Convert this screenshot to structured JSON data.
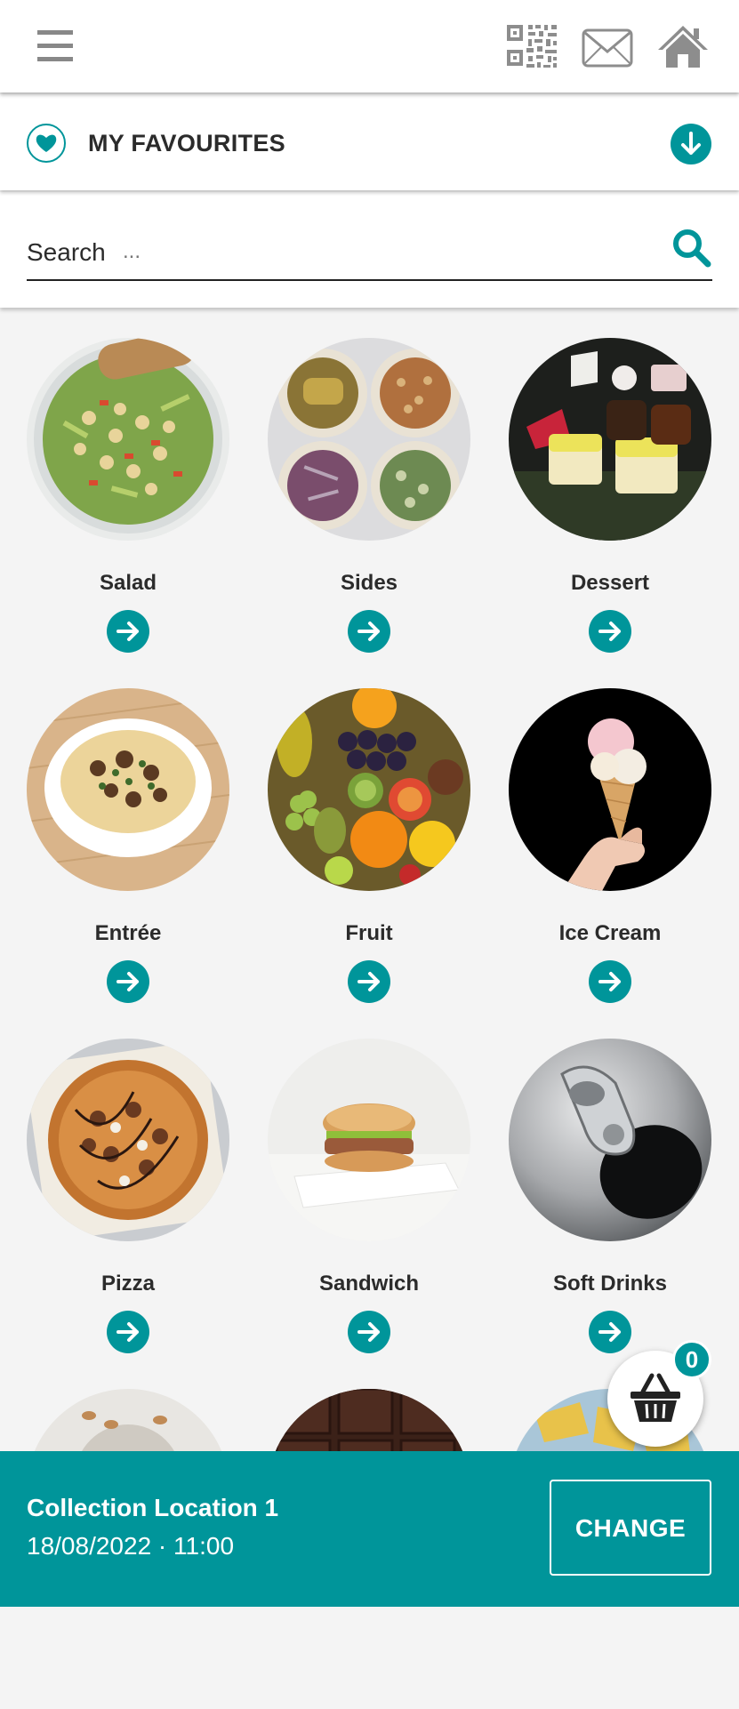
{
  "header": {
    "menu_icon": "hamburger-menu-icon",
    "qr_icon": "qr-code-icon",
    "mail_icon": "envelope-icon",
    "home_icon": "home-icon"
  },
  "favourites": {
    "title": "MY FAVOURITES",
    "icon": "heart-icon",
    "toggle_icon": "arrow-down-icon"
  },
  "search": {
    "label": "Search",
    "placeholder": "...",
    "icon": "search-icon"
  },
  "categories": [
    {
      "name": "Salad"
    },
    {
      "name": "Sides"
    },
    {
      "name": "Dessert"
    },
    {
      "name": "Entrée"
    },
    {
      "name": "Fruit"
    },
    {
      "name": "Ice Cream"
    },
    {
      "name": "Pizza"
    },
    {
      "name": "Sandwich"
    },
    {
      "name": "Soft Drinks"
    },
    {
      "name": ""
    },
    {
      "name": ""
    },
    {
      "name": ""
    }
  ],
  "basket": {
    "count": "0",
    "icon": "basket-icon"
  },
  "footer": {
    "location": "Collection Location 1",
    "datetime": "18/08/2022 · 11:00",
    "change_label": "CHANGE"
  },
  "colors": {
    "accent": "#00959a",
    "background": "#f4f4f4"
  }
}
